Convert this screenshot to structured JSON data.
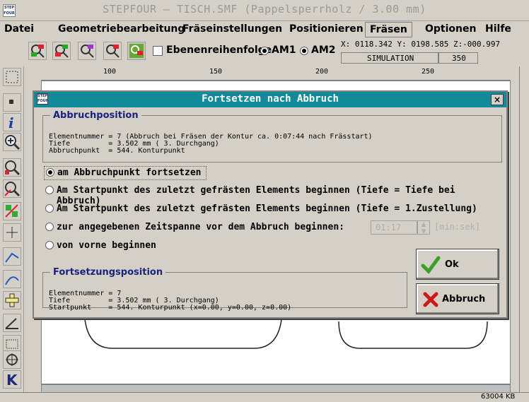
{
  "app": {
    "logo_text": "STEP FOUR",
    "title": "STEPFOUR – TISCH.SMF (Pappelsperrholz / 3.00 mm)"
  },
  "menu": [
    "Datei",
    "Geometriebearbeitung",
    "Fräseinstellungen",
    "Positionieren",
    "Fräsen",
    "Optionen",
    "Hilfe"
  ],
  "toolbar": {
    "ebenen_label": "Ebenenreihenfolge",
    "am1_label": "AM1",
    "am2_label": "AM2",
    "coords": "X: 0118.342 Y: 0198.585  Z:-000.997",
    "sim_label": "SIMULATION",
    "sim_value": "350"
  },
  "ruler": {
    "ticks": [
      "100",
      "150",
      "200",
      "250"
    ]
  },
  "dialog": {
    "title": "Fortsetzen nach Abbruch",
    "close": "×",
    "abbruch_section": {
      "legend": "Abbruchposition",
      "lines": [
        "Elementnummer = 7 (Abbruch bei Fräsen der Kontur ca. 0:07:44 nach Frässtart)",
        "Tiefe         = 3.502 mm ( 3. Durchgang)",
        "Abbruchpunkt  = 544. Konturpunkt"
      ]
    },
    "options": [
      "am Abbruchpunkt fortsetzen",
      "Am Startpunkt des zuletzt gefrästen Elements beginnen (Tiefe = Tiefe bei Abbruch)",
      "Am Startpunkt des zuletzt gefrästen Elements beginnen (Tiefe = 1.Zustellung)",
      "zur angegebenen Zeitspanne vor dem Abbruch beginnen:",
      "von vorne beginnen"
    ],
    "time_value": "01:17",
    "time_unit": "[min:sek]",
    "fortsetzung_section": {
      "legend": "Fortsetzungsposition",
      "lines": [
        "Elementnummer = 7",
        "Tiefe         = 3.502 mm ( 3. Durchgang)",
        "Startpunkt    = 544. Konturpunkt (x=0.00, y=0.00, z=0.00)"
      ]
    },
    "ok_label": "Ok",
    "abbruch_label": "Abbruch"
  },
  "status": {
    "memory": "63004 KB"
  },
  "colors": {
    "dialog_title": "#138a9a",
    "legend": "#1a237e",
    "ok_check": "#3aa02a",
    "cancel_x": "#cc1a1a"
  }
}
